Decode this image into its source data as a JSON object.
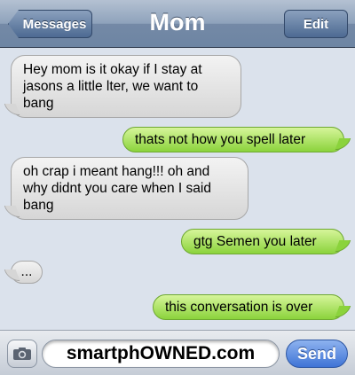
{
  "header": {
    "back_label": "Messages",
    "title": "Mom",
    "edit_label": "Edit"
  },
  "messages": [
    {
      "direction": "incoming",
      "text": "Hey mom is it okay if I stay at jasons a little lter, we want to bang"
    },
    {
      "direction": "outgoing",
      "text": "thats not how you spell later"
    },
    {
      "direction": "incoming",
      "text": "oh crap i meant hang!!! oh and why didnt you care when I said bang"
    },
    {
      "direction": "outgoing",
      "text": "gtg Semen you later"
    },
    {
      "direction": "incoming",
      "text": "..."
    },
    {
      "direction": "outgoing",
      "text": "this conversation is over"
    }
  ],
  "composer": {
    "camera_icon": "camera-icon",
    "field_text": "smartphOWNED.com",
    "send_label": "Send"
  },
  "colors": {
    "incoming_bubble": "#e6e6e6",
    "outgoing_bubble": "#a6e05c",
    "send_button": "#3f74d6",
    "background": "#dbe2ec"
  }
}
